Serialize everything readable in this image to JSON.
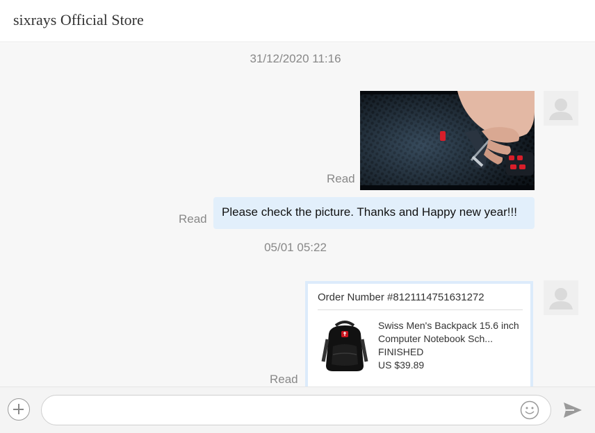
{
  "header": {
    "title": "sixrays Official Store"
  },
  "messages": {
    "timestamp_1": "31/12/2020 11:16",
    "image_read": "Read",
    "text_read": "Read",
    "text": "Please check the picture. Thanks and Happy new year!!!",
    "timestamp_2": "05/01 05:22",
    "order_read": "Read"
  },
  "order": {
    "number": "Order Number #8121114751631272",
    "product_name": "Swiss Men's Backpack 15.6 inch Computer Notebook Sch...",
    "status": "FINISHED",
    "price": "US $39.89"
  },
  "composer": {
    "placeholder": "",
    "value": ""
  },
  "icons": {
    "add": "plus-circle-icon",
    "emoji": "smiley-icon",
    "send": "send-arrow-icon",
    "avatar": "default-user-avatar"
  },
  "colors": {
    "bubble": "#e2effb",
    "card_border": "#dcebfb",
    "muted_text": "#888888"
  }
}
